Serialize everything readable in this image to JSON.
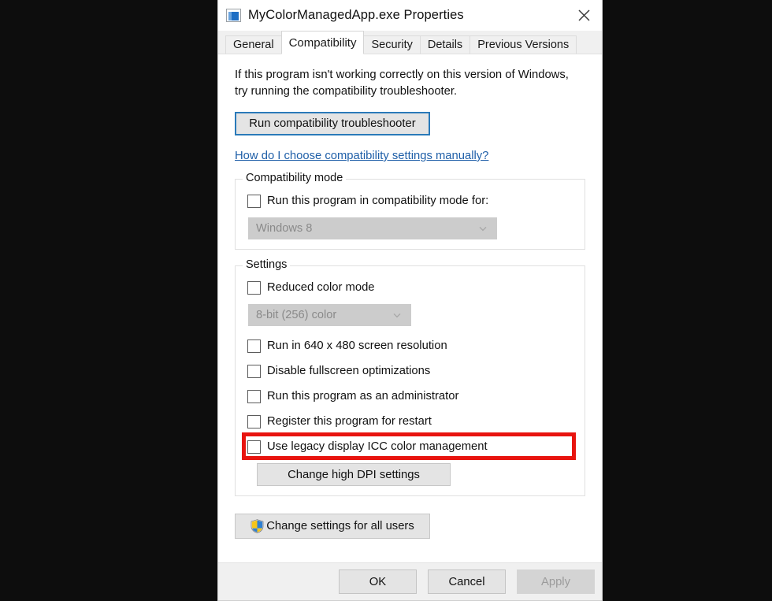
{
  "window": {
    "title": "MyColorManagedApp.exe Properties",
    "app_icon": "application-window-icon",
    "close_icon": "close-icon"
  },
  "tabs": [
    {
      "label": "General",
      "active": false
    },
    {
      "label": "Compatibility",
      "active": true
    },
    {
      "label": "Security",
      "active": false
    },
    {
      "label": "Details",
      "active": false
    },
    {
      "label": "Previous Versions",
      "active": false
    }
  ],
  "content": {
    "intro_text": "If this program isn't working correctly on this version of Windows, try running the compatibility troubleshooter.",
    "troubleshooter_button": "Run compatibility troubleshooter",
    "help_link": "How do I choose compatibility settings manually?"
  },
  "compatibility_mode": {
    "group_title": "Compatibility mode",
    "checkbox_label": "Run this program in compatibility mode for:",
    "checkbox_checked": false,
    "combo_value": "Windows 8",
    "combo_disabled": true,
    "combo_arrow_icon": "chevron-down-icon"
  },
  "settings": {
    "group_title": "Settings",
    "reduced_color_label": "Reduced color mode",
    "reduced_color_checked": false,
    "color_depth_value": "8-bit (256) color",
    "color_depth_disabled": true,
    "color_depth_arrow_icon": "chevron-down-icon",
    "checkboxes": [
      {
        "label": "Run in 640 x 480 screen resolution",
        "checked": false,
        "highlighted": false
      },
      {
        "label": "Disable fullscreen optimizations",
        "checked": false,
        "highlighted": false
      },
      {
        "label": "Run this program as an administrator",
        "checked": false,
        "highlighted": false
      },
      {
        "label": "Register this program for restart",
        "checked": false,
        "highlighted": false
      },
      {
        "label": "Use legacy display ICC color management",
        "checked": false,
        "highlighted": true
      }
    ],
    "dpi_button": "Change high DPI settings"
  },
  "all_users": {
    "button_label": "Change settings for all users",
    "shield_icon": "uac-shield-icon"
  },
  "footer": {
    "ok": "OK",
    "cancel": "Cancel",
    "apply": "Apply",
    "apply_disabled": true
  },
  "colors": {
    "highlight": "#e8140f",
    "link": "#1f5fa8",
    "focus_border": "#2a7ab9",
    "shield_blue": "#2f7fd0",
    "shield_yellow": "#f6c game"
  }
}
